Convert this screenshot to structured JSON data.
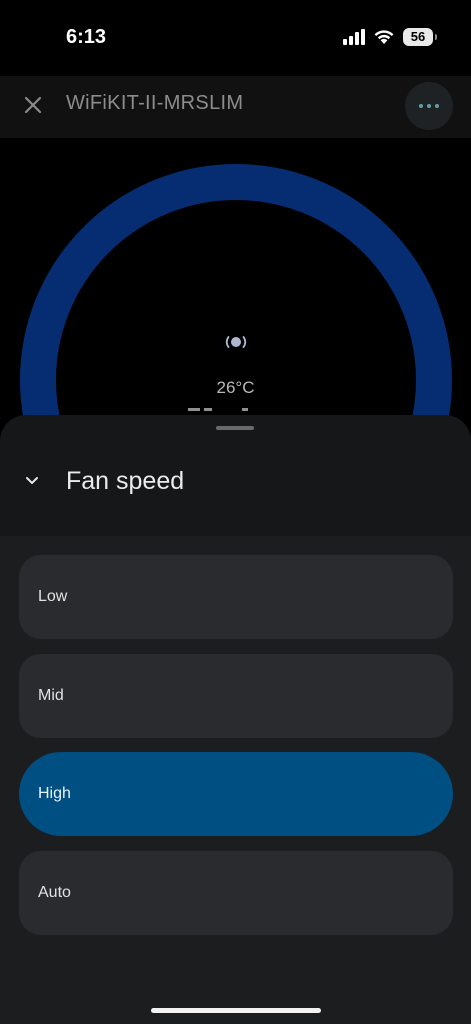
{
  "status_bar": {
    "time": "6:13",
    "battery": "56",
    "icons": [
      "signal-icon",
      "wifi-icon",
      "battery-icon"
    ]
  },
  "header": {
    "title": "WiFiKIT-II-MRSLIM",
    "close_icon": "close-icon",
    "more_icon": "more-options-icon"
  },
  "dial": {
    "temperature": "26°C",
    "mode_icon": "fan-mode-icon",
    "colors": {
      "ring": "#062d72"
    }
  },
  "sheet": {
    "title": "Fan speed",
    "collapse_icon": "chevron-down-icon",
    "options": [
      {
        "label": "Low",
        "selected": false
      },
      {
        "label": "Mid",
        "selected": false
      },
      {
        "label": "High",
        "selected": true
      },
      {
        "label": "Auto",
        "selected": false
      }
    ],
    "colors": {
      "selected": "#004f82",
      "option": "#2a2b2e"
    }
  }
}
